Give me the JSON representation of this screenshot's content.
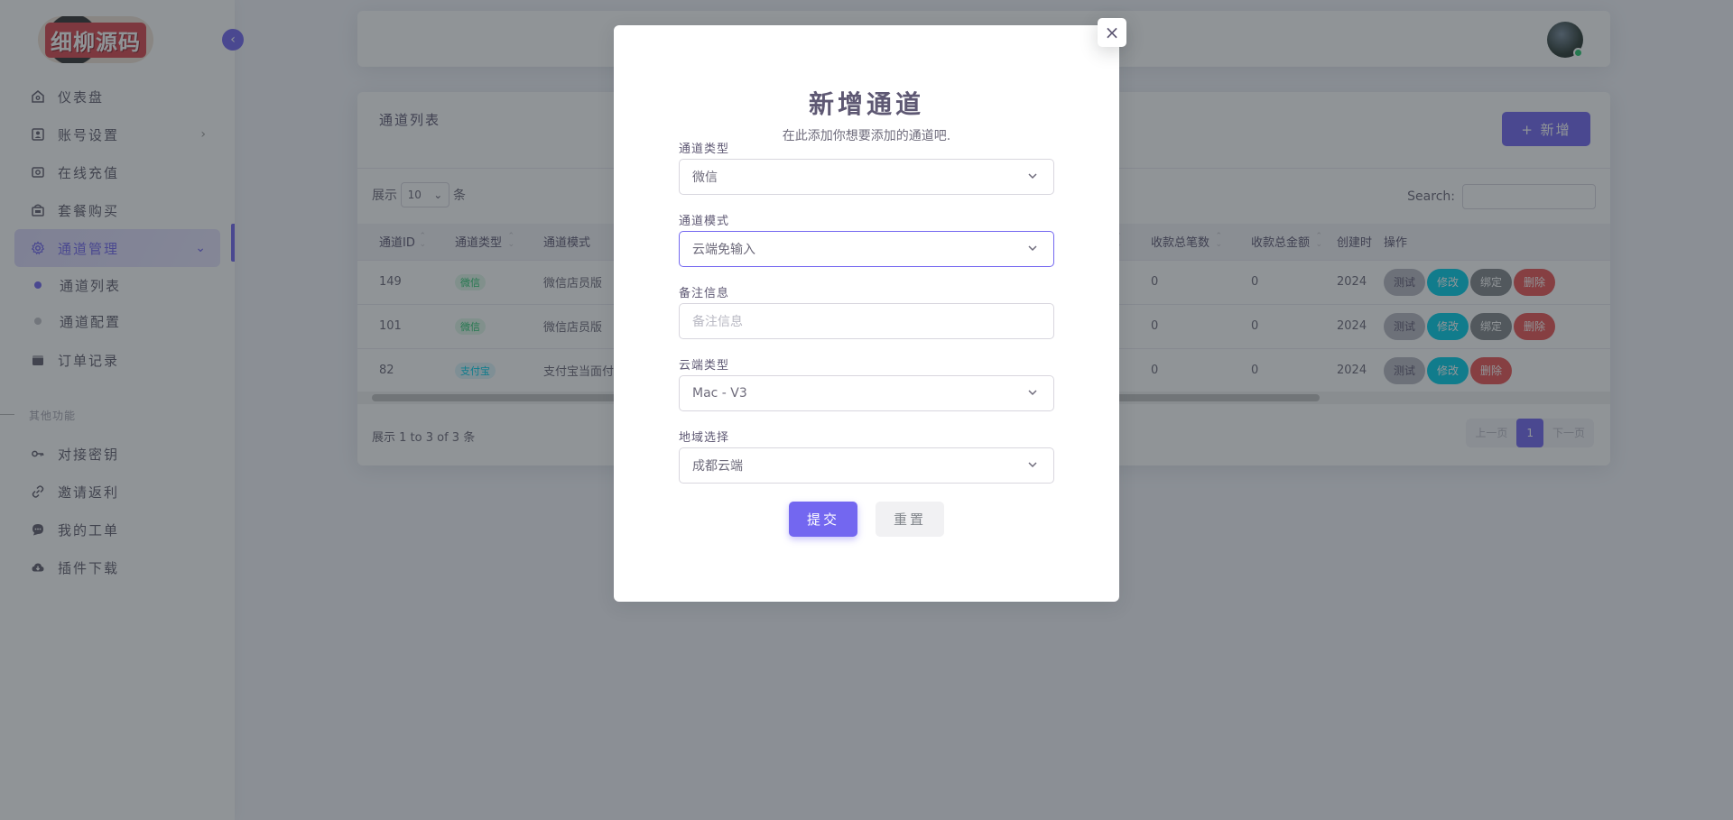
{
  "sidebar": {
    "logo_text": "细柳源码",
    "items": [
      {
        "label": "仪表盘"
      },
      {
        "label": "账号设置"
      },
      {
        "label": "在线充值"
      },
      {
        "label": "套餐购买"
      },
      {
        "label": "通道管理"
      },
      {
        "label": "订单记录"
      }
    ],
    "sub_items": [
      {
        "label": "通道列表"
      },
      {
        "label": "通道配置"
      }
    ],
    "section_label": "其他功能",
    "other_items": [
      {
        "label": "对接密钥"
      },
      {
        "label": "邀请返利"
      },
      {
        "label": "我的工单"
      },
      {
        "label": "插件下载"
      }
    ]
  },
  "card": {
    "title": "通道列表",
    "add_label": "+ 新增",
    "show_label": "展示",
    "page_len": "10",
    "entries_label": "条",
    "search_label": "Search:",
    "columns": [
      "通道ID",
      "通道类型",
      "通道模式",
      "收款总笔数",
      "收款总金额",
      "创建时",
      "操作"
    ],
    "rows": [
      {
        "id": "149",
        "type": "微信",
        "mode": "微信店员版",
        "count": "0",
        "amount": "0",
        "created": "2024",
        "ops": [
          "测试",
          "修改",
          "绑定",
          "删除"
        ]
      },
      {
        "id": "101",
        "type": "微信",
        "mode": "微信店员版",
        "count": "0",
        "amount": "0",
        "created": "2024",
        "ops": [
          "测试",
          "修改",
          "绑定",
          "删除"
        ]
      },
      {
        "id": "82",
        "type": "支付宝",
        "mode": "支付宝当面付",
        "count": "0",
        "amount": "0",
        "created": "2024",
        "ops": [
          "测试",
          "修改",
          "删除"
        ]
      }
    ],
    "info": "展示 1 to 3 of 3 条",
    "pager": {
      "prev": "上一页",
      "current": "1",
      "next": "下一页"
    }
  },
  "modal": {
    "title": "新增通道",
    "subtitle": "在此添加你想要添加的通道吧.",
    "fields": [
      {
        "label": "通道类型",
        "value": "微信"
      },
      {
        "label": "通道模式",
        "value": "云端免输入"
      },
      {
        "label": "备注信息",
        "placeholder": "备注信息"
      },
      {
        "label": "云端类型",
        "value": "Mac - V3"
      },
      {
        "label": "地域选择",
        "value": "成都云端"
      }
    ],
    "submit_label": "提交",
    "reset_label": "重置",
    "close_symbol": "×"
  },
  "colors": {
    "primary": "#7367f0",
    "success": "#28c76f",
    "info": "#00cfe8",
    "danger": "#ea5455"
  }
}
